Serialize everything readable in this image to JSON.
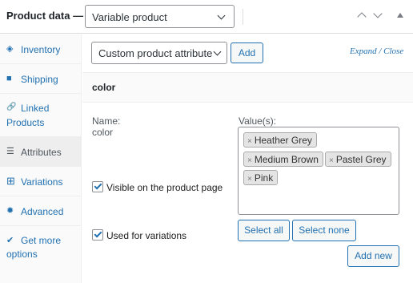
{
  "header": {
    "title": "Product data —",
    "product_type": "Variable product"
  },
  "sidebar": {
    "items": [
      {
        "icon": "tag-icon",
        "glyph": "◈",
        "label": "Inventory"
      },
      {
        "icon": "truck-icon",
        "glyph": "■",
        "label": "Shipping"
      },
      {
        "icon": "link-icon",
        "glyph": "🔗",
        "label": "Linked",
        "label2": "Products"
      },
      {
        "icon": "list-icon",
        "glyph": "☰",
        "label": "Attributes"
      },
      {
        "icon": "grid-icon",
        "glyph": "⊞",
        "label": "Variations"
      },
      {
        "icon": "gear-icon",
        "glyph": "✹",
        "label": "Advanced"
      },
      {
        "icon": "plugin-icon",
        "glyph": "✔",
        "label": "Get more",
        "label2": "options"
      }
    ]
  },
  "toolbar": {
    "attribute_select": "Custom product attribute",
    "add_label": "Add",
    "expand_close": "Expand / Close"
  },
  "attribute": {
    "heading": "color",
    "name_label": "Name:",
    "name_value": "color",
    "values_label": "Value(s):",
    "values": [
      "Heather Grey",
      "Medium Brown",
      "Pastel Grey",
      "Pink"
    ],
    "visible_label": "Visible on the product page",
    "visible_checked": true,
    "variations_label": "Used for variations",
    "variations_checked": true,
    "select_all": "Select all",
    "select_none": "Select none",
    "add_new": "Add new"
  },
  "colors": {
    "accent": "#2271b1",
    "border": "#8c8f94"
  }
}
